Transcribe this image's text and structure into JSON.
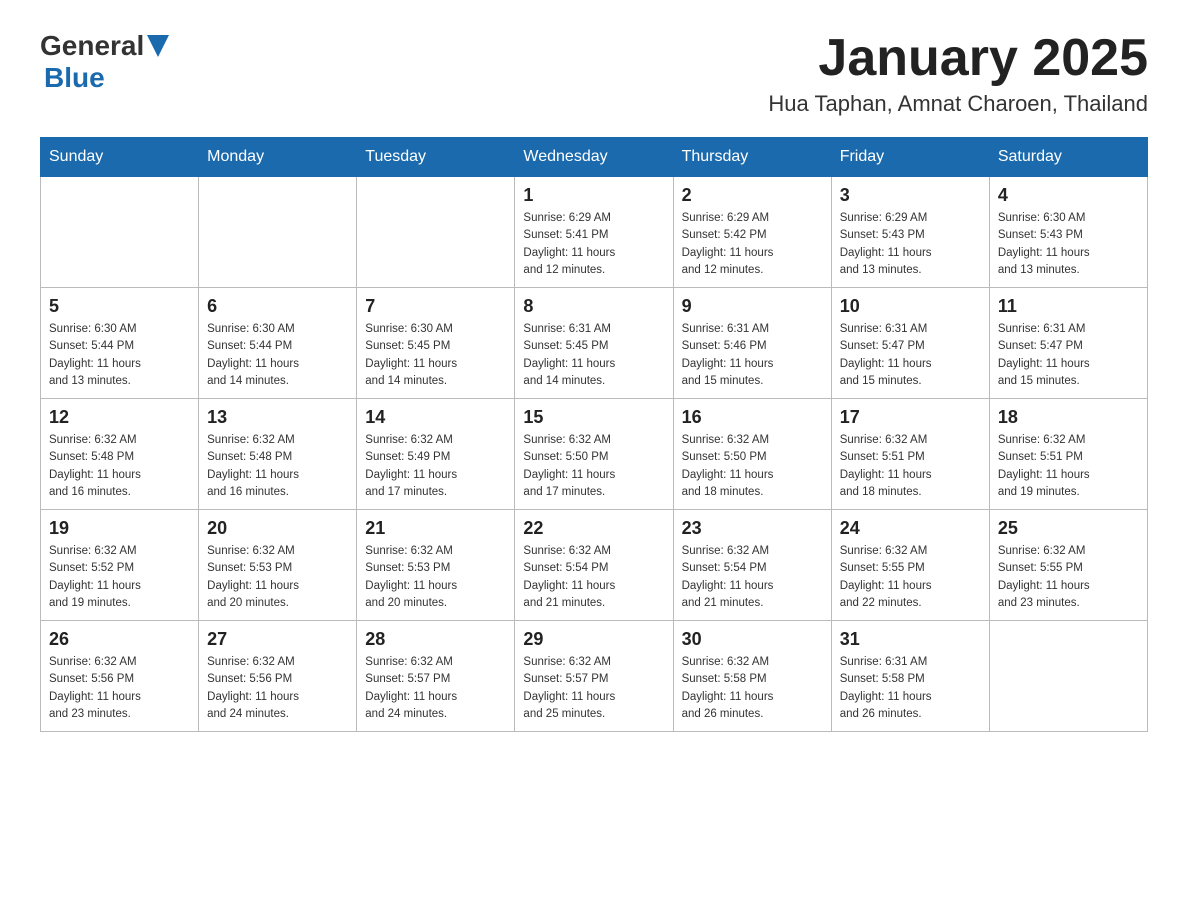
{
  "header": {
    "logo": {
      "general": "General",
      "blue": "Blue",
      "aria": "GeneralBlue logo"
    },
    "title": "January 2025",
    "location": "Hua Taphan, Amnat Charoen, Thailand"
  },
  "calendar": {
    "days_of_week": [
      "Sunday",
      "Monday",
      "Tuesday",
      "Wednesday",
      "Thursday",
      "Friday",
      "Saturday"
    ],
    "weeks": [
      [
        {
          "day": "",
          "info": ""
        },
        {
          "day": "",
          "info": ""
        },
        {
          "day": "",
          "info": ""
        },
        {
          "day": "1",
          "info": "Sunrise: 6:29 AM\nSunset: 5:41 PM\nDaylight: 11 hours\nand 12 minutes."
        },
        {
          "day": "2",
          "info": "Sunrise: 6:29 AM\nSunset: 5:42 PM\nDaylight: 11 hours\nand 12 minutes."
        },
        {
          "day": "3",
          "info": "Sunrise: 6:29 AM\nSunset: 5:43 PM\nDaylight: 11 hours\nand 13 minutes."
        },
        {
          "day": "4",
          "info": "Sunrise: 6:30 AM\nSunset: 5:43 PM\nDaylight: 11 hours\nand 13 minutes."
        }
      ],
      [
        {
          "day": "5",
          "info": "Sunrise: 6:30 AM\nSunset: 5:44 PM\nDaylight: 11 hours\nand 13 minutes."
        },
        {
          "day": "6",
          "info": "Sunrise: 6:30 AM\nSunset: 5:44 PM\nDaylight: 11 hours\nand 14 minutes."
        },
        {
          "day": "7",
          "info": "Sunrise: 6:30 AM\nSunset: 5:45 PM\nDaylight: 11 hours\nand 14 minutes."
        },
        {
          "day": "8",
          "info": "Sunrise: 6:31 AM\nSunset: 5:45 PM\nDaylight: 11 hours\nand 14 minutes."
        },
        {
          "day": "9",
          "info": "Sunrise: 6:31 AM\nSunset: 5:46 PM\nDaylight: 11 hours\nand 15 minutes."
        },
        {
          "day": "10",
          "info": "Sunrise: 6:31 AM\nSunset: 5:47 PM\nDaylight: 11 hours\nand 15 minutes."
        },
        {
          "day": "11",
          "info": "Sunrise: 6:31 AM\nSunset: 5:47 PM\nDaylight: 11 hours\nand 15 minutes."
        }
      ],
      [
        {
          "day": "12",
          "info": "Sunrise: 6:32 AM\nSunset: 5:48 PM\nDaylight: 11 hours\nand 16 minutes."
        },
        {
          "day": "13",
          "info": "Sunrise: 6:32 AM\nSunset: 5:48 PM\nDaylight: 11 hours\nand 16 minutes."
        },
        {
          "day": "14",
          "info": "Sunrise: 6:32 AM\nSunset: 5:49 PM\nDaylight: 11 hours\nand 17 minutes."
        },
        {
          "day": "15",
          "info": "Sunrise: 6:32 AM\nSunset: 5:50 PM\nDaylight: 11 hours\nand 17 minutes."
        },
        {
          "day": "16",
          "info": "Sunrise: 6:32 AM\nSunset: 5:50 PM\nDaylight: 11 hours\nand 18 minutes."
        },
        {
          "day": "17",
          "info": "Sunrise: 6:32 AM\nSunset: 5:51 PM\nDaylight: 11 hours\nand 18 minutes."
        },
        {
          "day": "18",
          "info": "Sunrise: 6:32 AM\nSunset: 5:51 PM\nDaylight: 11 hours\nand 19 minutes."
        }
      ],
      [
        {
          "day": "19",
          "info": "Sunrise: 6:32 AM\nSunset: 5:52 PM\nDaylight: 11 hours\nand 19 minutes."
        },
        {
          "day": "20",
          "info": "Sunrise: 6:32 AM\nSunset: 5:53 PM\nDaylight: 11 hours\nand 20 minutes."
        },
        {
          "day": "21",
          "info": "Sunrise: 6:32 AM\nSunset: 5:53 PM\nDaylight: 11 hours\nand 20 minutes."
        },
        {
          "day": "22",
          "info": "Sunrise: 6:32 AM\nSunset: 5:54 PM\nDaylight: 11 hours\nand 21 minutes."
        },
        {
          "day": "23",
          "info": "Sunrise: 6:32 AM\nSunset: 5:54 PM\nDaylight: 11 hours\nand 21 minutes."
        },
        {
          "day": "24",
          "info": "Sunrise: 6:32 AM\nSunset: 5:55 PM\nDaylight: 11 hours\nand 22 minutes."
        },
        {
          "day": "25",
          "info": "Sunrise: 6:32 AM\nSunset: 5:55 PM\nDaylight: 11 hours\nand 23 minutes."
        }
      ],
      [
        {
          "day": "26",
          "info": "Sunrise: 6:32 AM\nSunset: 5:56 PM\nDaylight: 11 hours\nand 23 minutes."
        },
        {
          "day": "27",
          "info": "Sunrise: 6:32 AM\nSunset: 5:56 PM\nDaylight: 11 hours\nand 24 minutes."
        },
        {
          "day": "28",
          "info": "Sunrise: 6:32 AM\nSunset: 5:57 PM\nDaylight: 11 hours\nand 24 minutes."
        },
        {
          "day": "29",
          "info": "Sunrise: 6:32 AM\nSunset: 5:57 PM\nDaylight: 11 hours\nand 25 minutes."
        },
        {
          "day": "30",
          "info": "Sunrise: 6:32 AM\nSunset: 5:58 PM\nDaylight: 11 hours\nand 26 minutes."
        },
        {
          "day": "31",
          "info": "Sunrise: 6:31 AM\nSunset: 5:58 PM\nDaylight: 11 hours\nand 26 minutes."
        },
        {
          "day": "",
          "info": ""
        }
      ]
    ]
  }
}
